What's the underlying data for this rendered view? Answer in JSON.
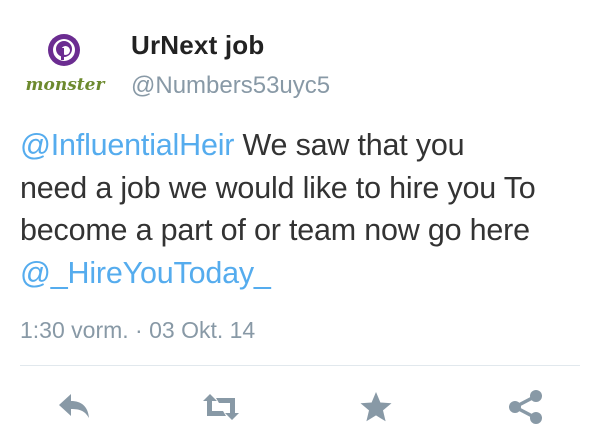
{
  "user": {
    "display_name": "UrNext job",
    "handle": "@Numbers53uyc5",
    "avatar_icon": "monster-logo-icon",
    "avatar_text": "monster"
  },
  "tweet": {
    "lines": [
      {
        "mention": "@InfluentialHeir",
        "text": " We saw that you"
      },
      {
        "mention": "",
        "text": "need a job we would like to hire you To"
      },
      {
        "mention": "",
        "text": "become a part of or team now go here"
      },
      {
        "mention": "@_HireYouToday_",
        "text": ""
      }
    ],
    "timestamp": "1:30 vorm. · 03 Okt. 14"
  },
  "actions": [
    {
      "name": "reply-icon"
    },
    {
      "name": "retweet-icon"
    },
    {
      "name": "favorite-icon"
    },
    {
      "name": "share-icon"
    }
  ],
  "colors": {
    "link": "#55acee",
    "meta": "#8899a6",
    "action_icon": "#8899a6",
    "logo_purple": "#6b2c91",
    "logo_green": "#6d8a2e"
  }
}
